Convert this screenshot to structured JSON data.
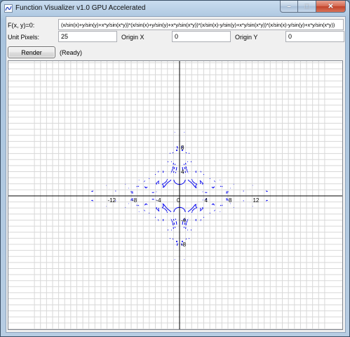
{
  "window": {
    "title": "Function Visualizer v1.0 GPU Accelerated",
    "minimize_glyph": "–",
    "maximize_glyph": "□",
    "close_glyph": "✕"
  },
  "form": {
    "formula_label": "F(x, y)=0:",
    "formula_value": "(x/sin(x)+y/sin(y)+x*y/sin(x*y))*(x/sin(x)+y/sin(y)+x*y/sin(x*y))*(x/sin(x)-y/sin(y)+x*y/sin(x*y))*(x/sin(x)-y/sin(y)+x*y/sin(x*y))",
    "unit_pixels_label": "Unit Pixels:",
    "unit_pixels_value": "25",
    "origin_x_label": "Origin X",
    "origin_x_value": "0",
    "origin_y_label": "Origin Y",
    "origin_y_value": "0",
    "render_label": "Render",
    "status": "(Ready)"
  },
  "plot": {
    "curve_color": "#0000ee",
    "axis_color": "#000000",
    "grid_color": "#d8d8d8",
    "x_tick_labels": [
      "-12",
      "-8",
      "-4",
      "0",
      "4",
      "8",
      "12"
    ],
    "y_tick_labels": [
      "8",
      "4",
      "-4",
      "-8"
    ]
  }
}
